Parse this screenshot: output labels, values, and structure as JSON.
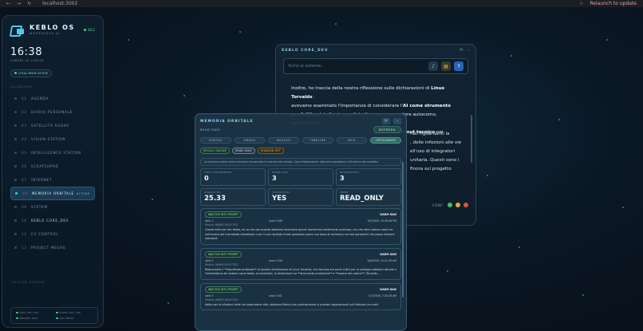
{
  "browser": {
    "url": "localhost:3002",
    "update_label": "Relaunch to update"
  },
  "sidebar": {
    "brand_name": "KEBLO OS",
    "brand_sub": "WORKSPACE AI",
    "status": "IDLE",
    "clock": "16:38",
    "date": "LUNEDI 10 LUGLIO",
    "local_label": "LOCAL MODE ACTIVE",
    "section_label": "LAUNCHER",
    "items": [
      {
        "num": "01",
        "label": "AGENDA"
      },
      {
        "num": "02",
        "label": "DIARIO PERSONALE"
      },
      {
        "num": "03",
        "label": "SATELLITE RADAR"
      },
      {
        "num": "04",
        "label": "VISION STATION"
      },
      {
        "num": "05",
        "label": "INTELLIGENCE STATION"
      },
      {
        "num": "06",
        "label": "SCRATCHPAD"
      },
      {
        "num": "07",
        "label": "INTERNET"
      },
      {
        "num": "08",
        "label": "MEMORIA ORBITALE",
        "tag": "ACTIVE"
      },
      {
        "num": "09",
        "label": "SYSTEM"
      },
      {
        "num": "10",
        "label": "KEBLO CORE_DEV"
      },
      {
        "num": "11",
        "label": "CV CONTROL"
      },
      {
        "num": "12",
        "label": "PROJECT MEGAS"
      }
    ],
    "system_title": "SYSTEM STATUS",
    "system": [
      {
        "label": "DISK: 100 / 100"
      },
      {
        "label": "LLAMA: 100 / 100"
      },
      {
        "label": "MEMORY: 100%"
      },
      {
        "label": "CPU: READY"
      }
    ]
  },
  "core": {
    "title": "KEBLO CORE_DEV",
    "placeholder": "Scrivi al sistema...",
    "line1": "Inoltre, ho traccia della nostra riflessione sulle dichiarazioni di ",
    "line1_bold": "Linus Torvalds",
    "line1_end": ":",
    "line2": "avevamo esaminato l'importanza di considerare l'",
    "line2_bold": "AI come strumento",
    "line3_bold": "produttivo",
    "line3": " (simile ai compilatori) e non come autore autonomo, sottolineando",
    "line4_bold": "burnout tecnico",
    "line4_end": " nei",
    "frag1": "nali riguardanti la",
    "frag2": ", delle infezioni alle vie",
    "frag3": "ell'uso di integratori",
    "frag4": "unitaria. Questi sono i",
    "frag5": "finora sul progetto",
    "conf_label": "CONF:",
    "conf_colors": [
      "#3fbf6b",
      "#e3a63b",
      "#d9534f"
    ]
  },
  "memory": {
    "title": "MEMORIA ORBITALE",
    "read_only": "READ ONLY",
    "refresh": "REFRESH",
    "tabs": [
      "STATUS",
      "GRAFO",
      "NUCLEO",
      "TIMELINE",
      "MCU",
      "IPPOCAMPO"
    ],
    "active_tab": "IPPOCAMPO",
    "chips": [
      "RECALL ONLINE",
      "READ ONLY",
      "SHADOW OFF"
    ],
    "info": "La scienza nuova sulla memoria recuperata e inserita nel prompt. Ogni elaborazione ulteriore appartiene all'interno del modello.",
    "stats": [
      {
        "label": "CODE EXPERIMENT",
        "value": "0"
      },
      {
        "label": "WARM MAX",
        "value": "3"
      },
      {
        "label": "SELEZIONATI",
        "value": "3"
      },
      {
        "label": "DURATA MS",
        "value": "25.33"
      },
      {
        "label": "TRUNCATED",
        "value": "YES"
      },
      {
        "label": "MODE",
        "value": "READ_ONLY"
      }
    ],
    "cards": [
      {
        "badge": "INJECTED INTO PROMPT",
        "kind": "WARM RAW",
        "rank": "rank 1",
        "score": "score 0.66",
        "ts": "5/7/2026, 15:26:48 PM",
        "motivo": "Motivo: WARM_SELECTED",
        "text": "Grazie mille per tee Keblo, mi sa che per quanto abbiamo lavoriamo quindi dovremmo sentimento qualcosa, piu che altro volevo capire se nell'analisi del microbiota intestinale e per il suo risultato finale possiamo avere una base di confronto con dei parametri che posso ritenere standard."
      },
      {
        "badge": "INJECTED INTO PROMPT",
        "kind": "WARM RAW",
        "rank": "rank 2",
        "score": "score 0.58",
        "ts": "5/6/2026, 10:41:39 AM",
        "motivo": "Motivo: WARM_SELECTED",
        "text": "Realizziamo il **significato profondo** di queste dichiarazioni di Linus Torvalds, che toccano tre punti critici per lo sviluppo software attuale e l'architettura dei sistemi come Keblo. Innanzitutto, la distinzione tra **strumento produttivo** e **autore del codice**: Torvalds..."
      },
      {
        "badge": "INJECTED INTO PROMPT",
        "kind": "WARM RAW",
        "rank": "rank 3",
        "score": "score 0.61",
        "ts": "5/7/2026, 7:30:28 AM",
        "motivo": "Motivo: WARM_SELECTED",
        "text": "Keblo per le infezioni delle vie respiratorie alte, abbiamo Marco che puntualmente si prende ragionamenti sull'infezioni una sett"
      }
    ]
  }
}
